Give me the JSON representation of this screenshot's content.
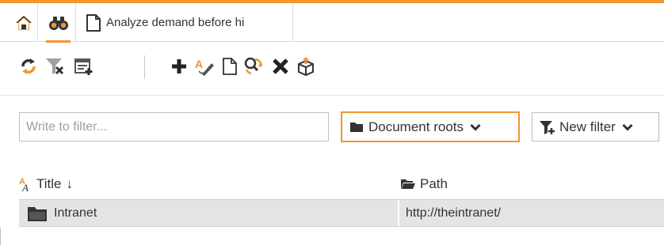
{
  "colors": {
    "accent": "#f0962f",
    "row_bg": "#e4e4e4"
  },
  "tabs": [
    {
      "icon": "home-icon"
    },
    {
      "icon": "binoculars-icon",
      "active": true
    },
    {
      "icon": "document-icon",
      "label": "Analyze demand before hi"
    }
  ],
  "toolbar": {
    "buttons": [
      "refresh-icon",
      "clear-filter-icon",
      "add-list-icon",
      "add-icon",
      "rename-icon",
      "new-document-icon",
      "search-replace-icon",
      "delete-icon",
      "package-icon"
    ]
  },
  "filter": {
    "placeholder": "Write to filter...",
    "value": ""
  },
  "scope_dropdown": {
    "label": "Document roots"
  },
  "new_filter": {
    "label": "New filter"
  },
  "table": {
    "columns": [
      {
        "label": "Title",
        "sort": "↓",
        "icon": "sort-alpha-icon"
      },
      {
        "label": "Path",
        "icon": "folder-open-icon"
      }
    ],
    "rows": [
      {
        "title": "Intranet",
        "path": "http://theintranet/"
      }
    ]
  }
}
